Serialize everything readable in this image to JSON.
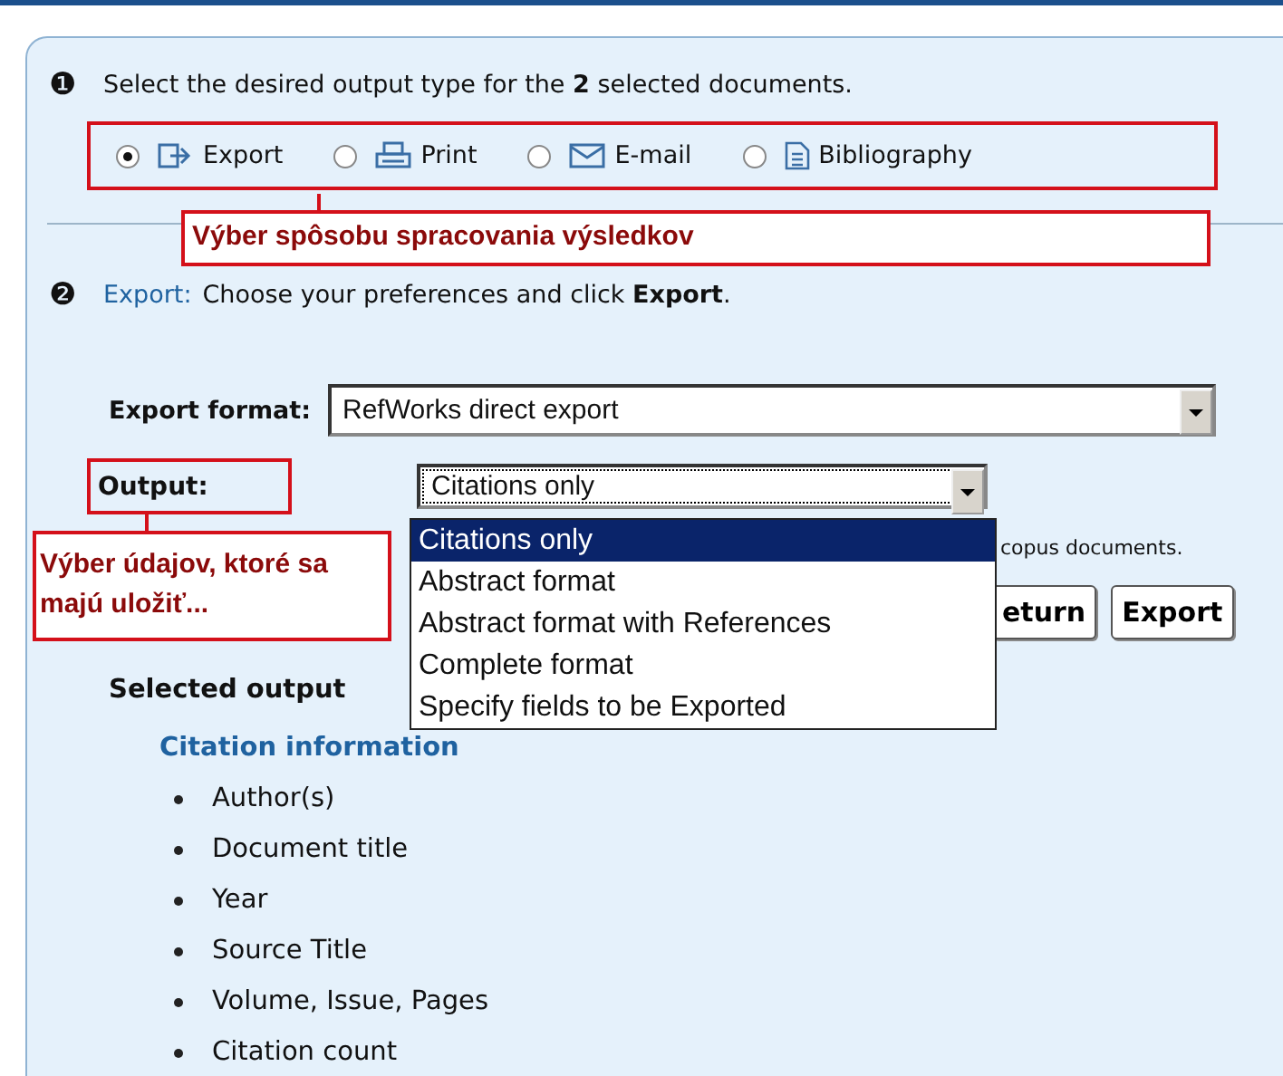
{
  "step1": {
    "number": "❶",
    "text": "Select the desired output type for the **2** selected documents."
  },
  "output_types": [
    {
      "label": "Export",
      "selected": true,
      "kind": "export"
    },
    {
      "label": "Print",
      "selected": false,
      "kind": "print"
    },
    {
      "label": "E-mail",
      "selected": false,
      "kind": "email"
    },
    {
      "label": "Bibliography",
      "selected": false,
      "kind": "bibliography"
    }
  ],
  "annotation_types": "Výber spôsobu spracovania výsledkov",
  "step2": {
    "number": "❷",
    "title": "Export:",
    "text": "Choose your preferences and click **Export**."
  },
  "export_format": {
    "label": "Export format:",
    "value": "RefWorks direct export"
  },
  "output": {
    "label": "Output:",
    "value": "Citations only",
    "expanded": true,
    "options": [
      {
        "label": "Citations only",
        "selected": true
      },
      {
        "label": "Abstract format",
        "selected": false
      },
      {
        "label": "Abstract format with References",
        "selected": false
      },
      {
        "label": "Complete format",
        "selected": false
      },
      {
        "label": "Specify fields to be Exported",
        "selected": false
      }
    ]
  },
  "annotation_output": "Výber údajov, ktoré sa majú uložiť...",
  "note": "copus documents.",
  "buttons": [
    "eturn",
    "Export"
  ],
  "selected_output_heading": "Selected output",
  "section_title": "Citation information",
  "fields": [
    "Author(s)",
    "Document title",
    "Year",
    "Source Title",
    "Volume, Issue, Pages",
    "Citation count"
  ]
}
